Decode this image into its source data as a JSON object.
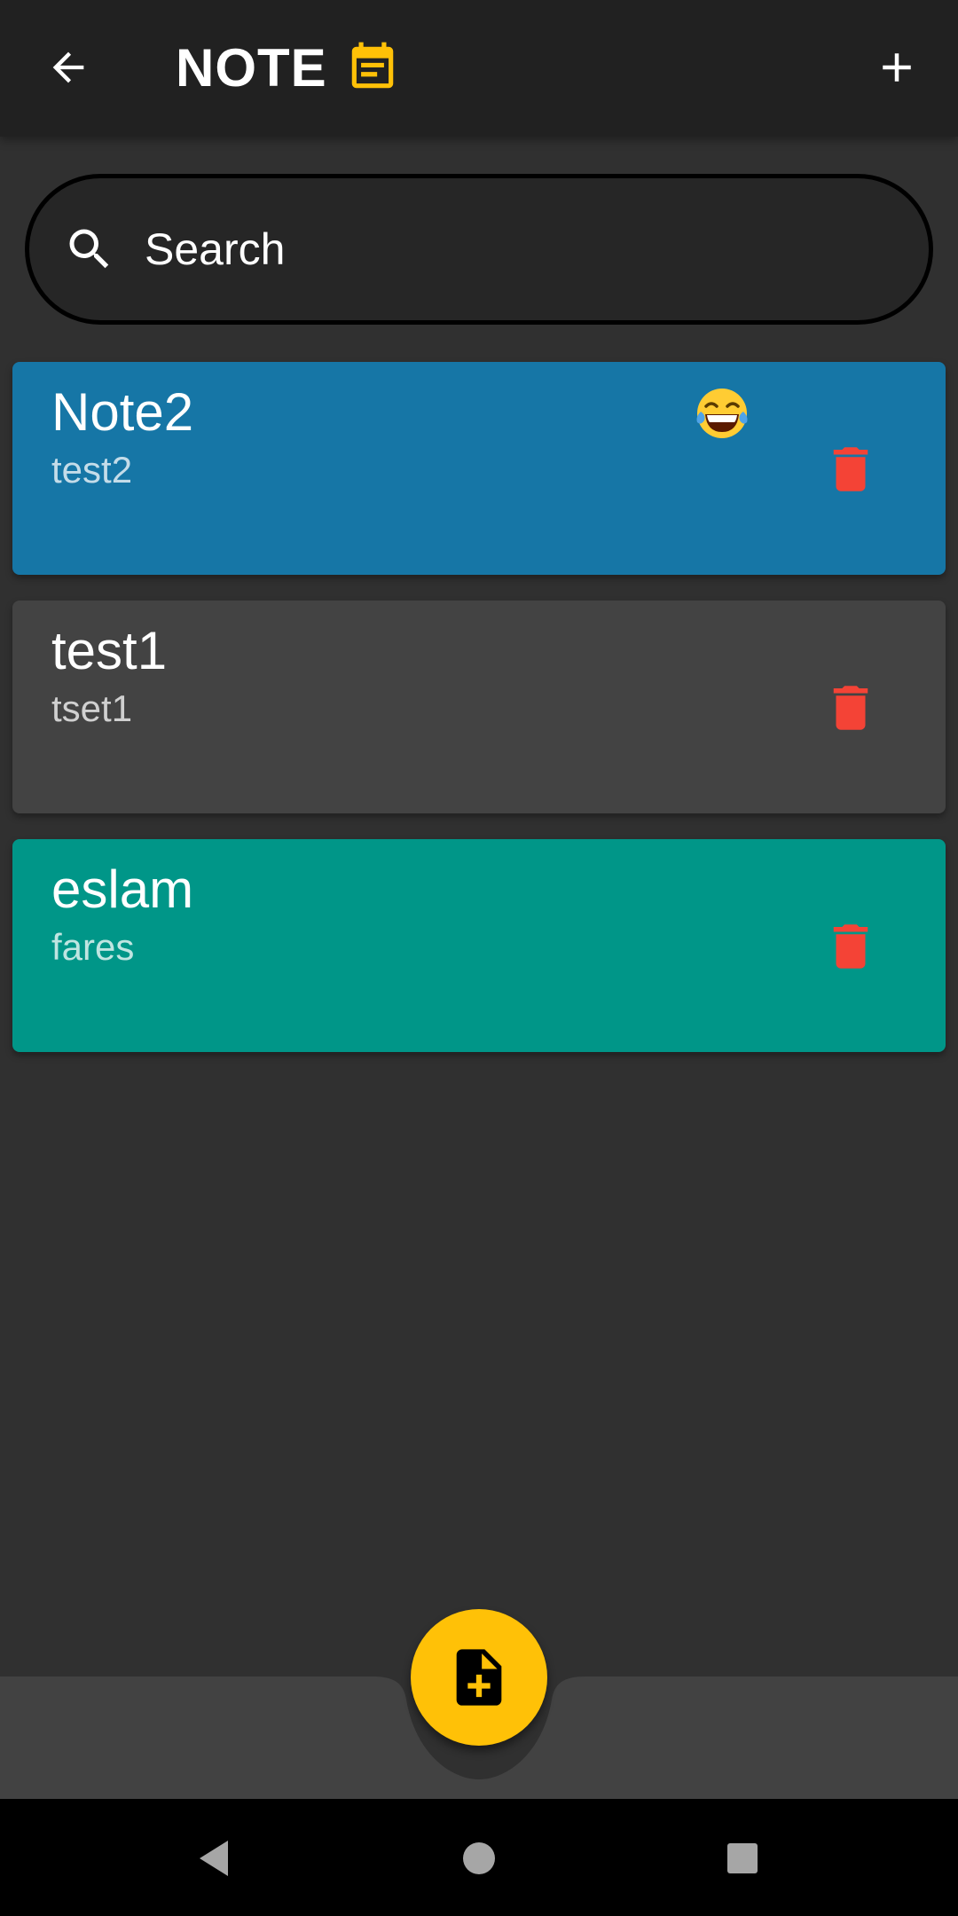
{
  "app_bar": {
    "title": "NOTE",
    "back_icon": "arrow-back-icon",
    "title_icon": "event-note-icon",
    "add_icon": "plus-icon",
    "accent_color": "#FFC107"
  },
  "search": {
    "placeholder": "Search",
    "value": "",
    "icon": "search-icon"
  },
  "notes": [
    {
      "title": "Note2",
      "body": "test2",
      "color": "#1676A6",
      "emoji": "😂",
      "delete_icon": "trash-icon"
    },
    {
      "title": "test1",
      "body": "tset1",
      "color": "#434343",
      "emoji": "",
      "delete_icon": "trash-icon"
    },
    {
      "title": "eslam",
      "body": "fares",
      "color": "#009688",
      "emoji": "",
      "delete_icon": "trash-icon"
    }
  ],
  "fab": {
    "icon": "note-add-icon",
    "color": "#FFC107"
  },
  "colors": {
    "background": "#303030",
    "app_bar": "#212121",
    "bottom_bar": "#424242",
    "delete": "#F44336"
  },
  "system_nav": {
    "back_icon": "nav-back-icon",
    "home_icon": "nav-home-icon",
    "recents_icon": "nav-recents-icon"
  }
}
